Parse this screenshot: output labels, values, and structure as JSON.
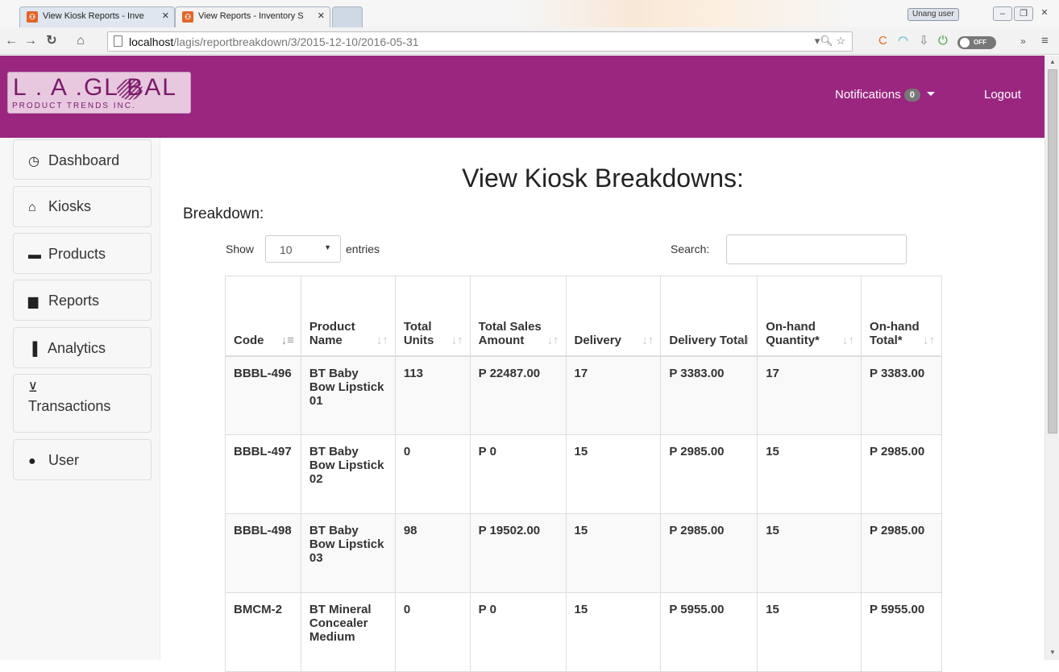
{
  "browser": {
    "tabs": [
      {
        "title": "View Kiosk Reports - Inve",
        "active": false
      },
      {
        "title": "View Reports - Inventory S",
        "active": true
      }
    ],
    "user_badge": "Unang user",
    "url_host": "localhost",
    "url_path": "/lagis/reportbreakdown/3/2015-12-10/2016-05-31",
    "toggle_label": "OFF"
  },
  "header": {
    "logo_big": "L . A .GL   BAL",
    "logo_small": "PRODUCT TRENDS INC.",
    "notifications_label": "Notifications",
    "notifications_count": "0",
    "logout_label": "Logout",
    "brand_color": "#9b2680"
  },
  "sidebar": {
    "items": [
      {
        "label": "Dashboard",
        "icon": "dashboard-icon"
      },
      {
        "label": "Kiosks",
        "icon": "home-icon"
      },
      {
        "label": "Products",
        "icon": "briefcase-icon"
      },
      {
        "label": "Reports",
        "icon": "file-icon"
      },
      {
        "label": "Analytics",
        "icon": "bar-chart-icon"
      },
      {
        "label": "Transactions",
        "icon": "cart-icon"
      },
      {
        "label": "User",
        "icon": "user-icon"
      }
    ]
  },
  "main": {
    "title": "View Kiosk Breakdowns:",
    "subtitle": "Breakdown:",
    "show_label": "Show",
    "page_length": "10",
    "entries_label": "entries",
    "search_label": "Search:",
    "search_value": "",
    "table": {
      "columns": [
        "Code",
        "Product Name",
        "Total Units",
        "Total Sales Amount",
        "Delivery",
        "Delivery Total",
        "On-hand Quantity*",
        "On-hand Total*"
      ],
      "rows": [
        [
          "BBBL-496",
          "BT Baby Bow Lipstick 01",
          "113",
          "P 22487.00",
          "17",
          "P 3383.00",
          "17",
          "P 3383.00"
        ],
        [
          "BBBL-497",
          "BT Baby Bow Lipstick 02",
          "0",
          "P 0",
          "15",
          "P 2985.00",
          "15",
          "P 2985.00"
        ],
        [
          "BBBL-498",
          "BT Baby Bow Lipstick 03",
          "98",
          "P 19502.00",
          "15",
          "P 2985.00",
          "15",
          "P 2985.00"
        ],
        [
          "BMCM-2",
          "BT Mineral Concealer Medium",
          "0",
          "P 0",
          "15",
          "P 5955.00",
          "15",
          "P 5955.00"
        ]
      ]
    }
  }
}
